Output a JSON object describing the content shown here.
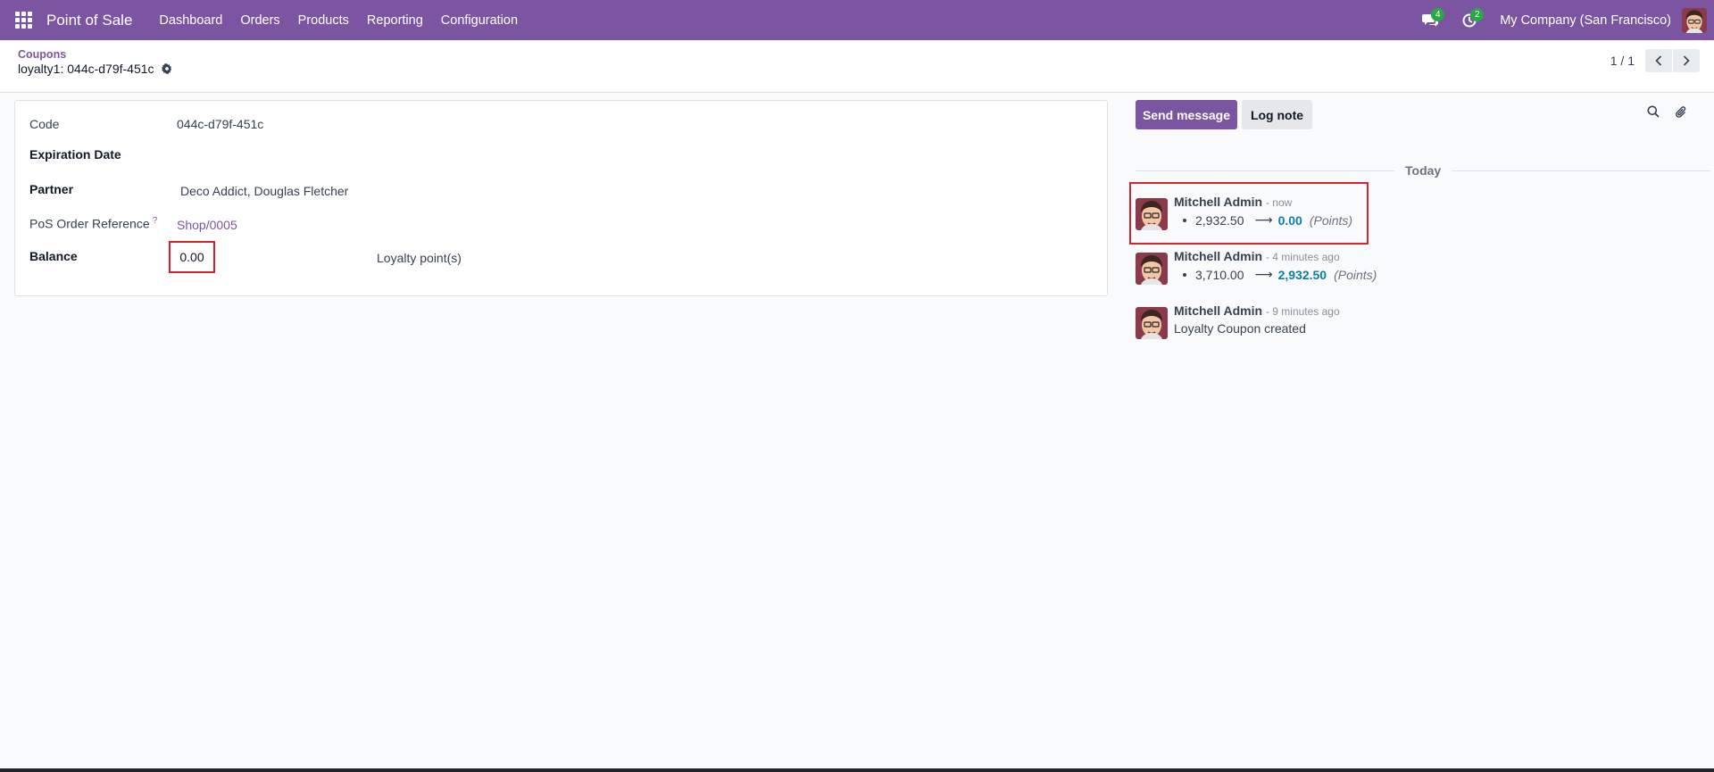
{
  "navbar": {
    "app_name": "Point of Sale",
    "menu": [
      "Dashboard",
      "Orders",
      "Products",
      "Reporting",
      "Configuration"
    ],
    "messages_badge": "4",
    "activities_badge": "2",
    "company": "My Company (San Francisco)",
    "bg_color": "#7c55a2"
  },
  "control": {
    "breadcrumb": "Coupons",
    "record_title": "loyalty1: 044c-d79f-451c",
    "pager_value": "1 / 1"
  },
  "form": {
    "code_label": "Code",
    "code_value": "044c-d79f-451c",
    "expiration_label": "Expiration Date",
    "partner_label": "Partner",
    "partner_value": "Deco Addict, Douglas Fletcher",
    "pos_ref_label": "PoS Order Reference",
    "pos_ref_tip": "?",
    "pos_ref_value": "Shop/0005",
    "balance_label": "Balance",
    "balance_value": "0.00",
    "balance_unit": "Loyalty point(s)"
  },
  "chatter": {
    "send_message": "Send message",
    "log_note": "Log note",
    "day_separator": "Today",
    "messages": [
      {
        "author": "Mitchell Admin",
        "date": "- now",
        "old": "2,932.50",
        "arrow": "⟶",
        "new": "0.00",
        "unit": "(Points)"
      },
      {
        "author": "Mitchell Admin",
        "date": "- 4 minutes ago",
        "old": "3,710.00",
        "arrow": "⟶",
        "new": "2,932.50",
        "unit": "(Points)"
      },
      {
        "author": "Mitchell Admin",
        "date": "- 9 minutes ago",
        "text": "Loyalty Coupon created"
      }
    ]
  }
}
